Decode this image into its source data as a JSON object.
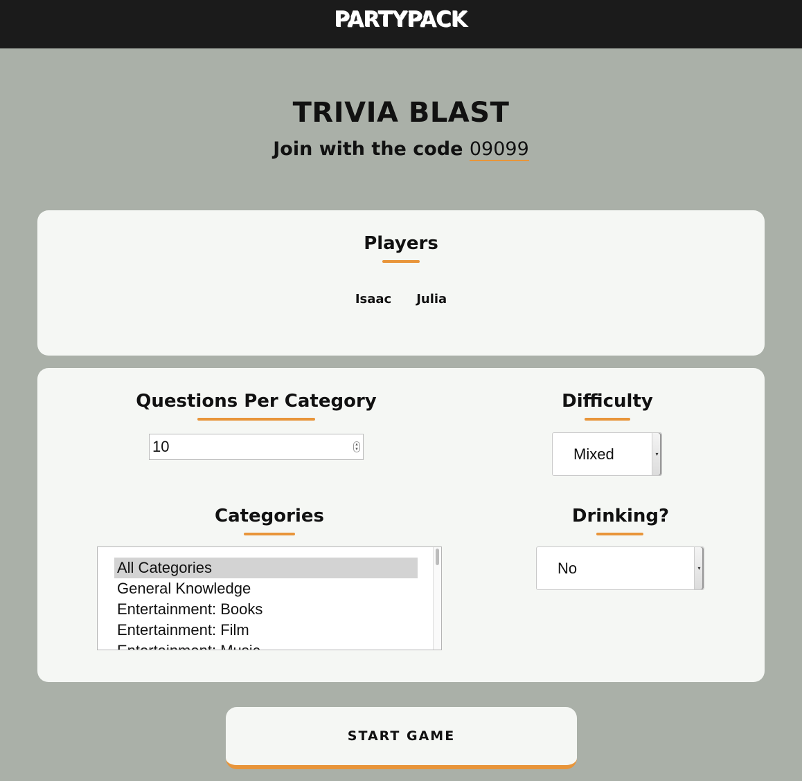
{
  "header": {
    "logo": "PARTYPACK"
  },
  "game": {
    "title": "TRIVIA BLAST",
    "join_prefix": "Join with the code ",
    "code": "09099"
  },
  "players": {
    "heading": "Players",
    "names": [
      "Isaac",
      "Julia"
    ]
  },
  "settings": {
    "questions_per_category": {
      "label": "Questions Per Category",
      "value": "10"
    },
    "difficulty": {
      "label": "Difficulty",
      "selected": "Mixed"
    },
    "categories": {
      "label": "Categories",
      "options": [
        "All Categories",
        "General Knowledge",
        "Entertainment: Books",
        "Entertainment: Film",
        "Entertainment: Music"
      ],
      "selected": "All Categories"
    },
    "drinking": {
      "label": "Drinking?",
      "selected": "No"
    }
  },
  "start_button": {
    "label": "START GAME"
  },
  "colors": {
    "accent": "#e8953a",
    "background": "#aab0a8",
    "card": "#f5f7f4",
    "topbar": "#1b1b1b"
  }
}
